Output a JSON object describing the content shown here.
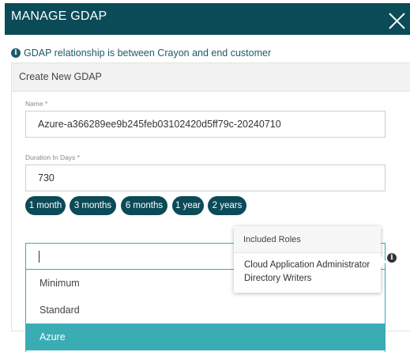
{
  "header": {
    "title": "MANAGE GDAP"
  },
  "info": {
    "text": "GDAP relationship is between Crayon and end customer"
  },
  "panel": {
    "title": "Create New GDAP"
  },
  "name_field": {
    "label": "Name *",
    "value": "Azure-a366289ee9b245feb03102420d5ff79c-20240710"
  },
  "duration_field": {
    "label": "Duration In Days *",
    "value": "730"
  },
  "duration_presets": [
    "1 month",
    "3 months",
    "6 months",
    "1 year",
    "2 years"
  ],
  "role_select": {
    "value": "",
    "options": [
      "Minimum",
      "Standard",
      "Azure"
    ],
    "selected": "Azure"
  },
  "tooltip": {
    "title": "Included Roles",
    "roles": [
      "Cloud Application Administrator",
      "Directory Writers"
    ]
  },
  "colors": {
    "header_bg": "#0b4a57",
    "accent": "#3aacb4",
    "info_text": "#1b5a6a"
  },
  "icons": [
    "close-icon",
    "info-icon"
  ]
}
